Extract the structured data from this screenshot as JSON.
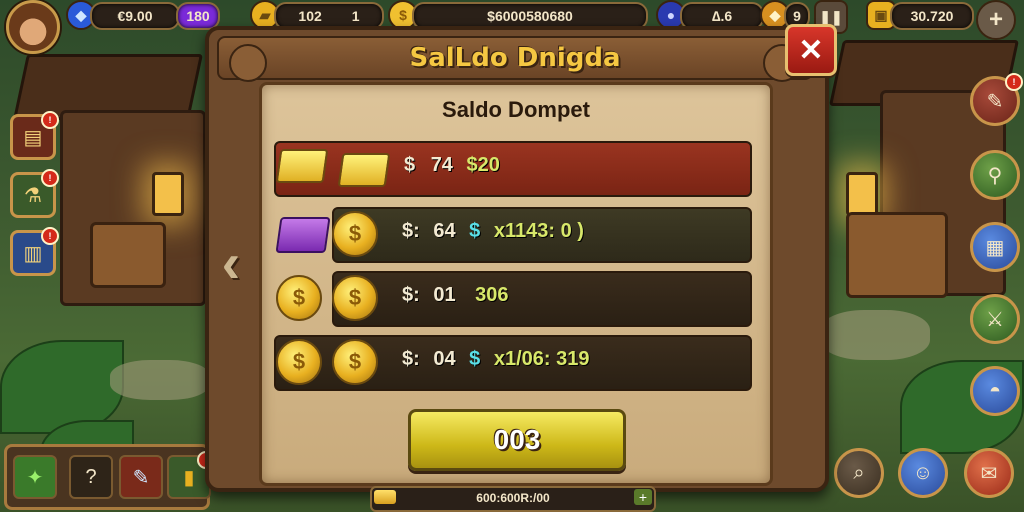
{
  "topbar": {
    "currency1": {
      "icon": "blue-gem-icon",
      "value": "€9.00"
    },
    "currency1_badge": "180",
    "gold_bars": {
      "icon": "gold-bar-icon",
      "value": "102",
      "side": "1"
    },
    "coins": {
      "icon": "coin-icon",
      "value": "$6000580680"
    },
    "orb": {
      "icon": "blue-orb-icon",
      "value": "∆.6"
    },
    "key": {
      "icon": "amber-gem-icon",
      "value": "9"
    },
    "treasure": {
      "icon": "gold-stack-icon",
      "value": "30.720"
    }
  },
  "dialog": {
    "title": "SalLdo Dnigda",
    "subtitle": "Saldo Dompet",
    "rows": [
      {
        "label": "$",
        "amount": "74",
        "value": "$20",
        "extra": ""
      },
      {
        "label": "$:",
        "amount": "64",
        "value": "$",
        "extra": "x1143: 0 )"
      },
      {
        "label": "$:",
        "amount": "01",
        "value": "306",
        "extra": ""
      },
      {
        "label": "$:",
        "amount": "04",
        "value": "$",
        "extra": "x1/06: 319"
      }
    ],
    "ok_label": "003"
  },
  "progress": {
    "text": "600:600R:/00",
    "fill": 0.08
  },
  "colors": {
    "accent_gold": "#f5c742",
    "row_red": "#8a2a1c",
    "row_dark": "#2e2418",
    "close_red": "#d8362a"
  }
}
